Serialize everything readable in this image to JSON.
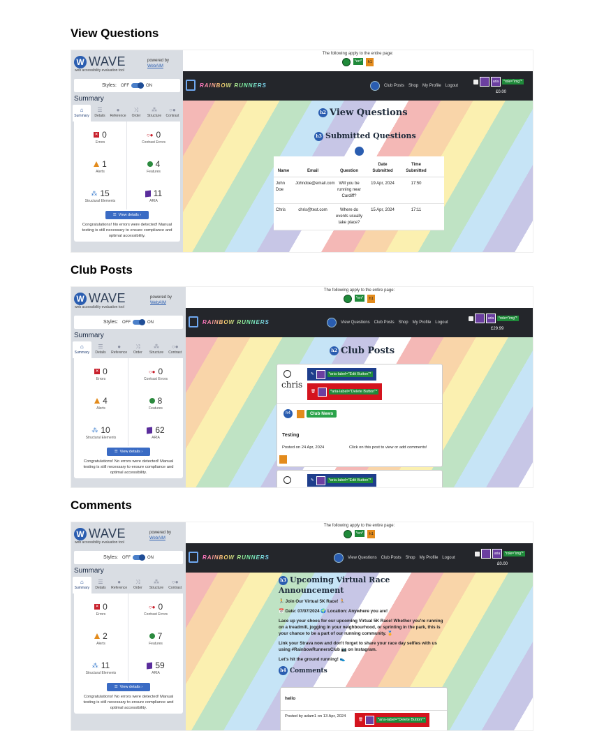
{
  "sections": [
    {
      "title": "View Questions"
    },
    {
      "title": "Club Posts"
    },
    {
      "title": "Comments"
    }
  ],
  "wave": {
    "logo_text": "WAVE",
    "tagline": "web accessibility evaluation tool",
    "powered_by": "powered by",
    "webaim": "WebAIM",
    "styles_label": "Styles:",
    "styles_off": "OFF",
    "styles_on": "ON",
    "summary_heading": "Summary",
    "tabs": [
      "Summary",
      "Details",
      "Reference",
      "Order",
      "Structure",
      "Contrast"
    ],
    "cap_errors": "Errors",
    "cap_contrast": "Contrast Errors",
    "cap_alerts": "Alerts",
    "cap_features": "Features",
    "cap_structural": "Structural Elements",
    "cap_aria": "ARIA",
    "view_details": "View details ›",
    "congrats": "Congratulations! No errors were detected! Manual testing is still necessary to ensure compliance and optimal accessibility."
  },
  "summaries": [
    {
      "errors": "0",
      "contrast": "0",
      "alerts": "1",
      "features": "4",
      "structural": "15",
      "aria": "11"
    },
    {
      "errors": "0",
      "contrast": "0",
      "alerts": "4",
      "features": "8",
      "structural": "10",
      "aria": "62"
    },
    {
      "errors": "0",
      "contrast": "0",
      "alerts": "2",
      "features": "7",
      "structural": "11",
      "aria": "59"
    }
  ],
  "site": {
    "applies": "The following apply to the entire page:",
    "en_badge": "*en*",
    "h1_badge": "h1",
    "brand": "RAINBOW RUNNERS",
    "nav_short": [
      "Club Posts",
      "Shop",
      "My Profile",
      "Logout"
    ],
    "nav_full": [
      "View Questions",
      "Club Posts",
      "Shop",
      "My Profile",
      "Logout"
    ],
    "role_img": "*role=\"img\"*",
    "aria": "aria",
    "price_zero": "£0.00",
    "price_2999": "£29.99"
  },
  "questions_page": {
    "title": "View Questions",
    "subtitle": "Submitted Questions",
    "h2": "h2",
    "h3": "h3",
    "headers": [
      "Name",
      "Email",
      "Question",
      "Date Submitted",
      "Time Submitted"
    ],
    "rows": [
      {
        "name": "John Doe",
        "email": "Johndoe@email.com",
        "question": "Will you be running near Cardiff?",
        "date": "19 Apr, 2024",
        "time": "17:50"
      },
      {
        "name": "Chris",
        "email": "chris@test.com",
        "question": "Where do events usually take place?",
        "date": "15 Apr, 2024",
        "time": "17:11"
      }
    ]
  },
  "posts_page": {
    "title": "Club Posts",
    "author": "chris",
    "edit_label": "*aria-label=\"Edit Button\"*",
    "delete_label": "*aria-label=\"Delete Button\"*",
    "h4": "h4",
    "badge": "Club News",
    "post_title": "Testing",
    "posted_on": "Posted on 24 Apr, 2024",
    "cta": "Click on this post to view or add comments!"
  },
  "comments_page": {
    "title": "Upcoming Virtual Race Announcement",
    "line1": "🏃 Join Our Virtual 5K Race! 🏃",
    "line2": "📅 Date: 07/07/2024 🌍 Location: Anywhere you are!",
    "para1": "Lace up your shoes for our upcoming Virtual 5K Race! Whether you're running on a treadmill, jogging in your neighbourhood, or sprinting in the park, this is your chance to be a part of our running community. 🏅",
    "para2": "Link your Strava now and don't forget to share your race day selfies with us using #RainbowRunnersClub 📷 on Instagram.",
    "para3": "Let's hit the ground running! 👟",
    "comments_heading": "Comments",
    "comment_text": "hello",
    "comment_meta": "Posted by adam1 on 13 Apr, 2024",
    "delete_label": "*aria-label=\"Delete Button\"*"
  }
}
